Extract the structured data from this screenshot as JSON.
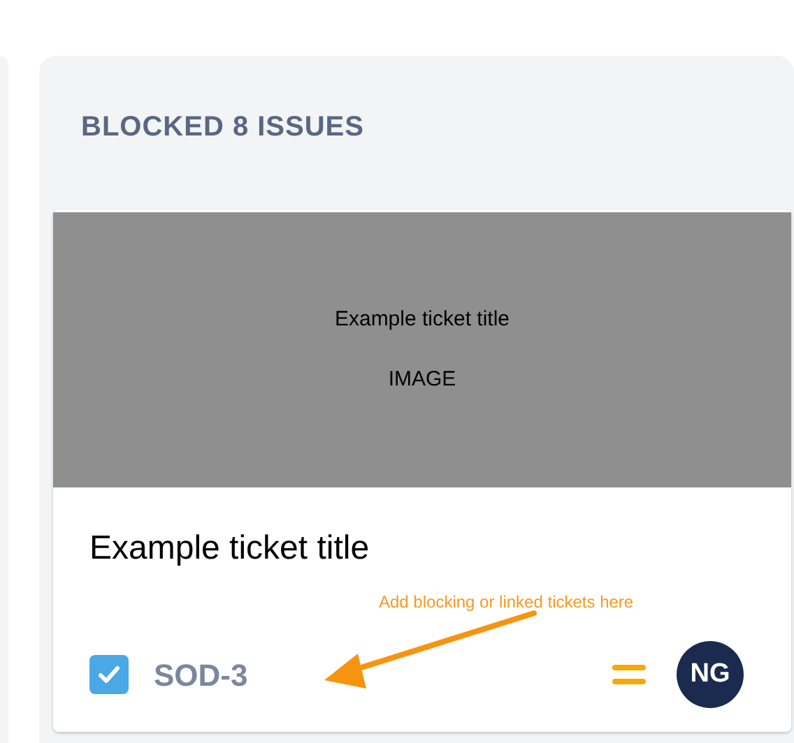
{
  "column": {
    "title": "BLOCKED 8 ISSUES"
  },
  "card": {
    "image": {
      "caption": "Example ticket title",
      "label": "IMAGE"
    },
    "title": "Example ticket title",
    "done": {
      "checked": true
    },
    "key": "SOD-3",
    "assignee": {
      "initials": "NG"
    }
  },
  "annotation": {
    "text": "Add blocking or linked tickets here"
  }
}
